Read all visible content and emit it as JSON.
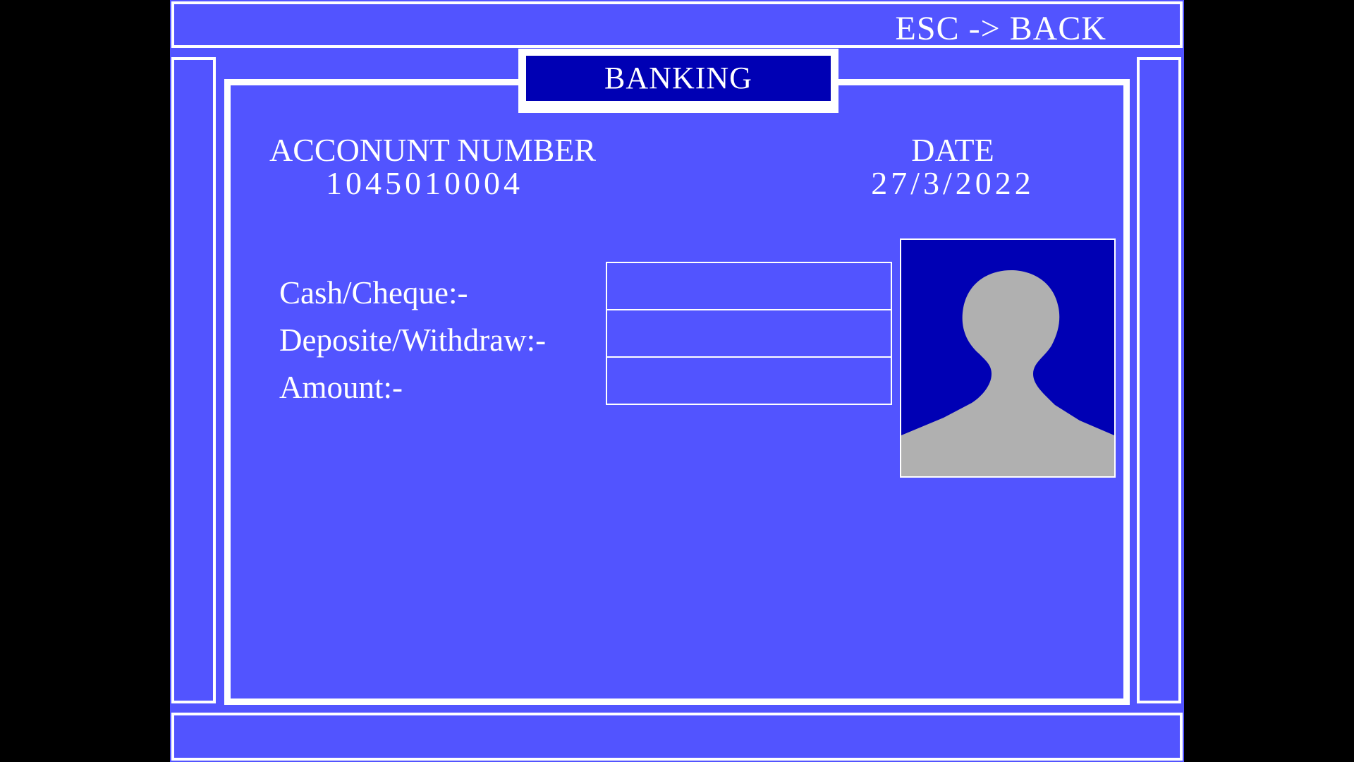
{
  "header": {
    "esc_hint": "ESC -> BACK"
  },
  "title": "BANKING",
  "account": {
    "label": "ACCONUNT NUMBER",
    "number": "1045010004"
  },
  "date": {
    "label": "DATE",
    "value": "27/3/2022"
  },
  "form": {
    "cash_cheque_label": "Cash/Cheque:-",
    "cash_cheque_value": "",
    "deposit_withdraw_label": "Deposite/Withdraw:-",
    "deposit_withdraw_value": "",
    "amount_label": "Amount:-",
    "amount_value": ""
  },
  "photo": {
    "icon": "user-silhouette-icon"
  },
  "colors": {
    "screen_background": "#5254ff",
    "dark_panel": "#0000b4",
    "border": "#ffffff",
    "silhouette": "#b0b0b0",
    "letterbox": "#000000"
  }
}
